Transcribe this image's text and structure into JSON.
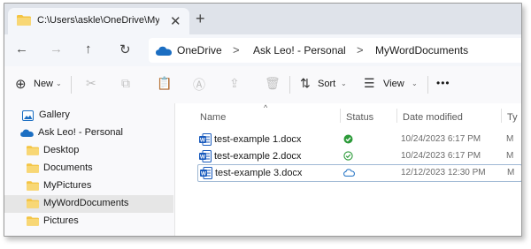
{
  "window": {
    "tab_title": "C:\\Users\\askle\\OneDrive\\MyW",
    "close_glyph": "✕",
    "newtab_glyph": "+"
  },
  "nav": {
    "back_glyph": "←",
    "forward_glyph": "→",
    "up_glyph": "↑",
    "refresh_glyph": "↻",
    "breadcrumbs": [
      "OneDrive",
      "Ask Leo! - Personal",
      "MyWordDocuments"
    ],
    "separator": ">"
  },
  "toolbar": {
    "new_label": "New",
    "sort_label": "Sort",
    "view_label": "View",
    "more_label": "•••",
    "chevron": "⌄",
    "icons": {
      "new": "⊕",
      "cut": "✂",
      "copy": "⧉",
      "paste": "📋",
      "rename": "Ⓐ",
      "share": "⇪",
      "delete": "🗑",
      "sort": "⇅",
      "view": "☰"
    }
  },
  "sidebar": {
    "items": [
      {
        "label": "Gallery",
        "icon": "gallery-icon"
      },
      {
        "label": "Ask Leo! - Personal",
        "icon": "onedrive-cloud-icon"
      },
      {
        "label": "Desktop",
        "icon": "folder-icon"
      },
      {
        "label": "Documents",
        "icon": "folder-icon"
      },
      {
        "label": "MyPictures",
        "icon": "folder-icon"
      },
      {
        "label": "MyWordDocuments",
        "icon": "folder-icon",
        "selected": true
      },
      {
        "label": "Pictures",
        "icon": "folder-icon"
      }
    ]
  },
  "columns": {
    "name": "Name",
    "status": "Status",
    "date": "Date modified",
    "type": "Ty",
    "sort_caret": "^"
  },
  "files": [
    {
      "name": "test-example 1.docx",
      "status": "available-filled",
      "date": "10/24/2023 6:17 PM",
      "type": "M"
    },
    {
      "name": "test-example 2.docx",
      "status": "available-outline",
      "date": "10/24/2023 6:17 PM",
      "type": "M"
    },
    {
      "name": "test-example 3.docx",
      "status": "online-only",
      "date": "12/12/2023 12:30 PM",
      "type": "M"
    }
  ],
  "colors": {
    "accent": "#1b6ec2",
    "folder": "#f4c442",
    "status_green": "#2d9b3a",
    "word_blue": "#185abd"
  }
}
